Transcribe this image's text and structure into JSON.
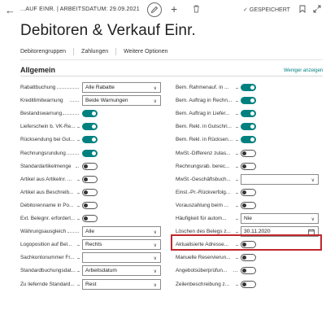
{
  "header": {
    "doc_title": "...AUF EINR. | ARBEITSDATUM: 29.09.2021",
    "saved_label": "GESPEICHERT",
    "page_title": "Debitoren & Verkauf Einr."
  },
  "actions": [
    "Debitorengruppen",
    "Zahlungen",
    "Weitere Optionen"
  ],
  "section": {
    "title": "Allgemein",
    "less_link": "Weniger anzeigen"
  },
  "left_fields": [
    {
      "label": "Rabattbuchung",
      "type": "select",
      "value": "Alle Rabatte"
    },
    {
      "label": "Kreditlimitwarnung",
      "type": "select",
      "value": "Beide Warnungen"
    },
    {
      "label": "Bestandswarnung",
      "type": "toggle",
      "on": true
    },
    {
      "label": "Lieferschein b. VK-Re...",
      "type": "toggle",
      "on": true
    },
    {
      "label": "Rücksendung bei Gut...",
      "type": "toggle",
      "on": true
    },
    {
      "label": "Rechnungsrundung",
      "type": "toggle",
      "on": true
    },
    {
      "label": "Standardartikelmenge",
      "type": "toggle",
      "on": false
    },
    {
      "label": "Artikel aus Artikelnr. ...",
      "type": "toggle",
      "on": false
    },
    {
      "label": "Artikel aus Beschreib...",
      "type": "toggle",
      "on": false
    },
    {
      "label": "Debitorenname in Po...",
      "type": "toggle",
      "on": false
    },
    {
      "label": "Ext. Belegnr. erforderl...",
      "type": "toggle",
      "on": false
    },
    {
      "label": "Währungsausgleich",
      "type": "select",
      "value": "Alle"
    },
    {
      "label": "Logoposition auf Bel...",
      "type": "select",
      "value": "Rechts"
    },
    {
      "label": "Sachkontonummer Fr...",
      "type": "select",
      "value": ""
    },
    {
      "label": "Standardbuchungsdat...",
      "type": "select",
      "value": "Arbeitsdatum"
    },
    {
      "label": "Zu liefernde Standard...",
      "type": "select",
      "value": "Rest"
    }
  ],
  "right_fields": [
    {
      "label": "Bem. Rahmenauf. in ...",
      "type": "toggle",
      "on": true
    },
    {
      "label": "Bem. Auftrag in Rechn...",
      "type": "toggle",
      "on": true
    },
    {
      "label": "Bem. Auftrag in Liefer...",
      "type": "toggle",
      "on": true
    },
    {
      "label": "Bem. Rekl. in Gutschri...",
      "type": "toggle",
      "on": true
    },
    {
      "label": "Bem. Rekl. in Rücksen...",
      "type": "toggle",
      "on": true
    },
    {
      "label": "MwSt.-Differenz zulas...",
      "type": "toggle",
      "on": false
    },
    {
      "label": "Rechnungsrab. berec...",
      "type": "toggle",
      "on": false
    },
    {
      "label": "MwSt.-Geschäftsbuch...",
      "type": "select",
      "value": ""
    },
    {
      "label": "Einst.-Pr.-Rückverfolg...",
      "type": "toggle",
      "on": false
    },
    {
      "label": "Vorauszahlung beim ...",
      "type": "toggle",
      "on": false
    },
    {
      "label": "Häufigkeit für autom...",
      "type": "select",
      "value": "Nie"
    },
    {
      "label": "Löschen des Belegs z...",
      "type": "date",
      "value": "30.11.2020"
    },
    {
      "label": "Aktualisierte Adresse...",
      "type": "toggle",
      "on": false
    },
    {
      "label": "Manuelle Reservierun...",
      "type": "toggle",
      "on": false
    },
    {
      "label": "Angebotsüberprüfun...",
      "type": "toggle",
      "on": false
    },
    {
      "label": "Zeilenbeschreibung z...",
      "type": "toggle",
      "on": false
    }
  ],
  "colors": {
    "accent": "#00817f",
    "highlight": "#c0272d"
  }
}
